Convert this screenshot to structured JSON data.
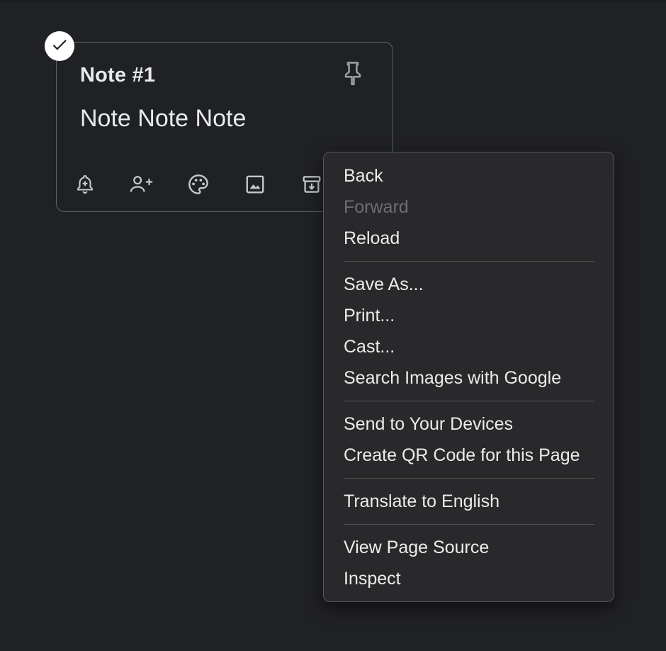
{
  "note": {
    "title": "Note #1",
    "body": "Note Note Note",
    "selected": true,
    "icons": {
      "select": "checkmark-icon",
      "pin": "pin-icon",
      "toolbar": [
        "reminder-bell-icon",
        "collaborator-icon",
        "palette-icon",
        "image-icon",
        "archive-icon"
      ]
    }
  },
  "context_menu": {
    "groups": [
      [
        {
          "label": "Back",
          "enabled": true
        },
        {
          "label": "Forward",
          "enabled": false
        },
        {
          "label": "Reload",
          "enabled": true
        }
      ],
      [
        {
          "label": "Save As...",
          "enabled": true
        },
        {
          "label": "Print...",
          "enabled": true
        },
        {
          "label": "Cast...",
          "enabled": true
        },
        {
          "label": "Search Images with Google",
          "enabled": true
        }
      ],
      [
        {
          "label": "Send to Your Devices",
          "enabled": true
        },
        {
          "label": "Create QR Code for this Page",
          "enabled": true
        }
      ],
      [
        {
          "label": "Translate to English",
          "enabled": true
        }
      ],
      [
        {
          "label": "View Page Source",
          "enabled": true
        },
        {
          "label": "Inspect",
          "enabled": true
        }
      ]
    ]
  },
  "colors": {
    "background": "#202124",
    "menu_background": "#29292b",
    "text": "#e8eaed",
    "disabled_text": "#6e6e70"
  }
}
